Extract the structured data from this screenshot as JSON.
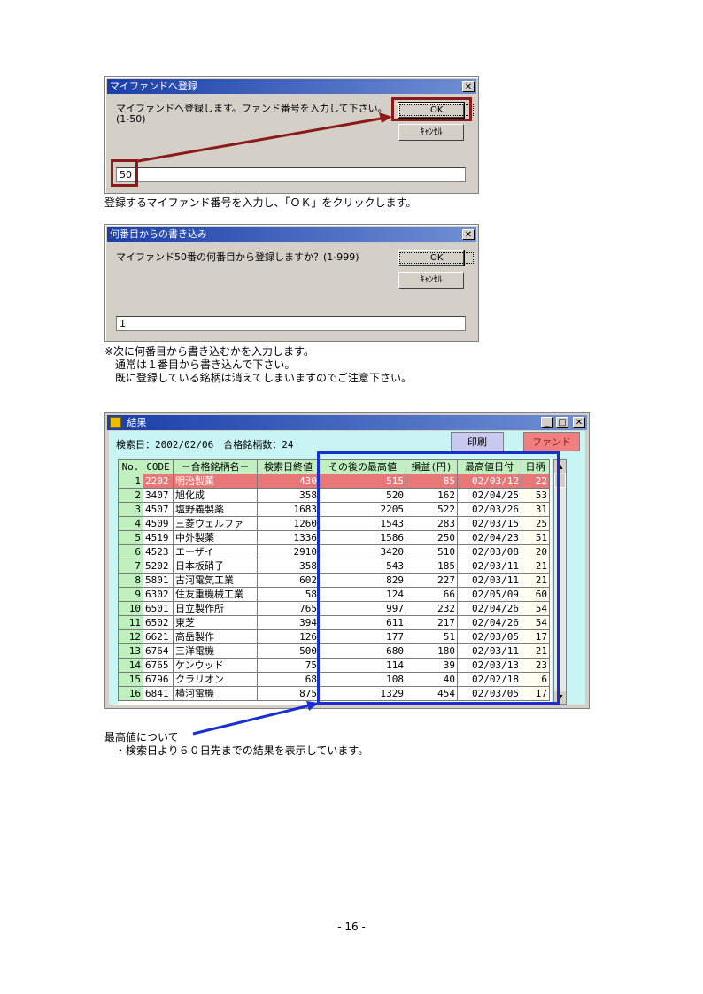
{
  "dialog1": {
    "title": "マイファンドへ登録",
    "message1": "マイファンドへ登録します。ファンド番号を入力して下さい。",
    "message2": "(1-50)",
    "ok_label": "OK",
    "cancel_label": "ｷｬﾝｾﾙ",
    "close_label": "✕",
    "input_value": "50"
  },
  "caption1": "登録するマイファンド番号を入力し、「ＯＫ」をクリックします。",
  "dialog2": {
    "title": "何番目からの書き込み",
    "message1": "マイファンド50番の何番目から登録しますか？(1-999)",
    "ok_label": "OK",
    "cancel_label": "ｷｬﾝｾﾙ",
    "close_label": "✕",
    "input_value": "1"
  },
  "caption2": {
    "line1": "※次に何番目から書き込むかを入力します。",
    "line2": "　通常は１番目から書き込んで下さい。",
    "line3": "　既に登録している銘柄は消えてしまいますのでご注意下さい。"
  },
  "result": {
    "title": "結果",
    "search_info": "検索日：2002/02/06　合格銘柄数：24",
    "print_label": "印刷",
    "fund_label": "ファンド",
    "min_label": "_",
    "max_label": "□",
    "close_label": "✕",
    "columns": [
      "No.",
      "CODE",
      "－合格銘柄名－",
      "検索日終値",
      "その後の最高値",
      "損益(円)",
      "最高値日付",
      "日柄"
    ],
    "rows": [
      [
        "1",
        "2202",
        "明治製菓",
        "430",
        "515",
        "85",
        "02/03/12",
        "22"
      ],
      [
        "2",
        "3407",
        "旭化成",
        "358",
        "520",
        "162",
        "02/04/25",
        "53"
      ],
      [
        "3",
        "4507",
        "塩野義製薬",
        "1683",
        "2205",
        "522",
        "02/03/26",
        "31"
      ],
      [
        "4",
        "4509",
        "三菱ウェルファ",
        "1260",
        "1543",
        "283",
        "02/03/15",
        "25"
      ],
      [
        "5",
        "4519",
        "中外製薬",
        "1336",
        "1586",
        "250",
        "02/04/23",
        "51"
      ],
      [
        "6",
        "4523",
        "エーザイ",
        "2910",
        "3420",
        "510",
        "02/03/08",
        "20"
      ],
      [
        "7",
        "5202",
        "日本板硝子",
        "358",
        "543",
        "185",
        "02/03/11",
        "21"
      ],
      [
        "8",
        "5801",
        "古河電気工業",
        "602",
        "829",
        "227",
        "02/03/11",
        "21"
      ],
      [
        "9",
        "6302",
        "住友重機械工業",
        "58",
        "124",
        "66",
        "02/05/09",
        "60"
      ],
      [
        "10",
        "6501",
        "日立製作所",
        "765",
        "997",
        "232",
        "02/04/26",
        "54"
      ],
      [
        "11",
        "6502",
        "東芝",
        "394",
        "611",
        "217",
        "02/04/26",
        "54"
      ],
      [
        "12",
        "6621",
        "高岳製作",
        "126",
        "177",
        "51",
        "02/03/05",
        "17"
      ],
      [
        "13",
        "6764",
        "三洋電機",
        "500",
        "680",
        "180",
        "02/03/11",
        "21"
      ],
      [
        "14",
        "6765",
        "ケンウッド",
        "75",
        "114",
        "39",
        "02/03/13",
        "23"
      ],
      [
        "15",
        "6796",
        "クラリオン",
        "68",
        "108",
        "40",
        "02/02/18",
        "6"
      ],
      [
        "16",
        "6841",
        "横河電機",
        "875",
        "1329",
        "454",
        "02/03/05",
        "17"
      ]
    ]
  },
  "note": {
    "line1": "最高値について",
    "line2": "　・検索日より６０日先までの結果を表示しています。"
  },
  "page_number": "- 16 -",
  "colors": {
    "highlight_red": "#8b1a1a",
    "highlight_blue": "#1a2fd0",
    "selected_row": "#e87878",
    "fund_button": "#f08080",
    "print_button": "#c8c8f0"
  }
}
